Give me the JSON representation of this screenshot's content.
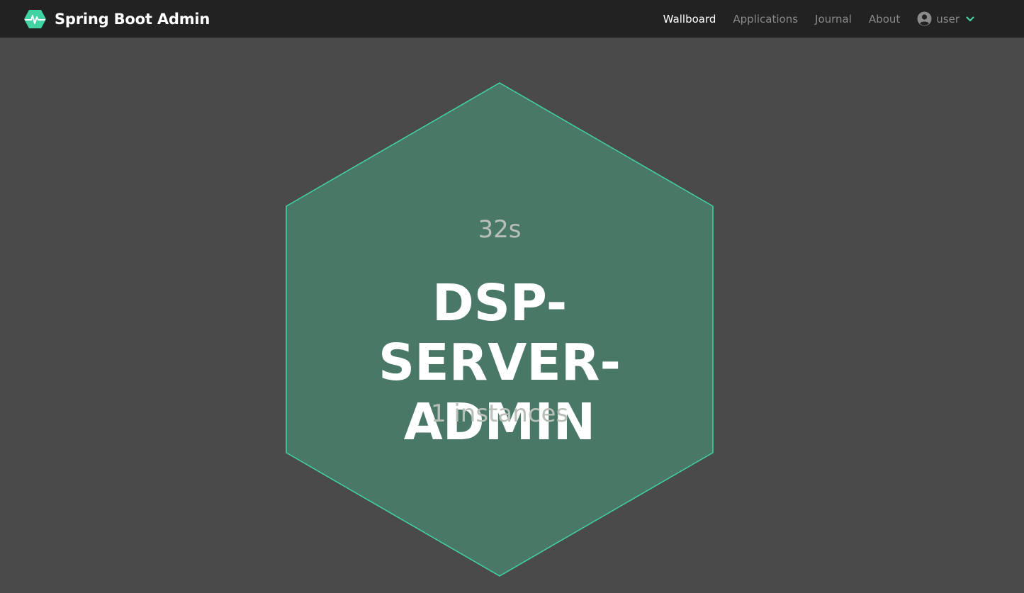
{
  "navbar": {
    "brand": {
      "name": "Spring Boot Admin",
      "logo_icon": "heartbeat-hexagon-icon"
    },
    "links": [
      {
        "label": "Wallboard",
        "active": true
      },
      {
        "label": "Applications",
        "active": false
      },
      {
        "label": "Journal",
        "active": false
      },
      {
        "label": "About",
        "active": false
      }
    ],
    "user": {
      "name": "user",
      "icon": "user-circle-icon",
      "dropdown_icon": "chevron-down-icon"
    }
  },
  "wallboard": {
    "application": {
      "time": "32s",
      "name": "DSP-SERVER-ADMIN",
      "instances": "1 instances",
      "status": "UP"
    }
  },
  "colors": {
    "navbar_bg": "#222222",
    "page_bg": "#4a4a4a",
    "accent": "#42d3a5",
    "hex_fill": "#497867",
    "hex_stroke": "#42d3a5",
    "muted_text": "#b7bfb6"
  }
}
